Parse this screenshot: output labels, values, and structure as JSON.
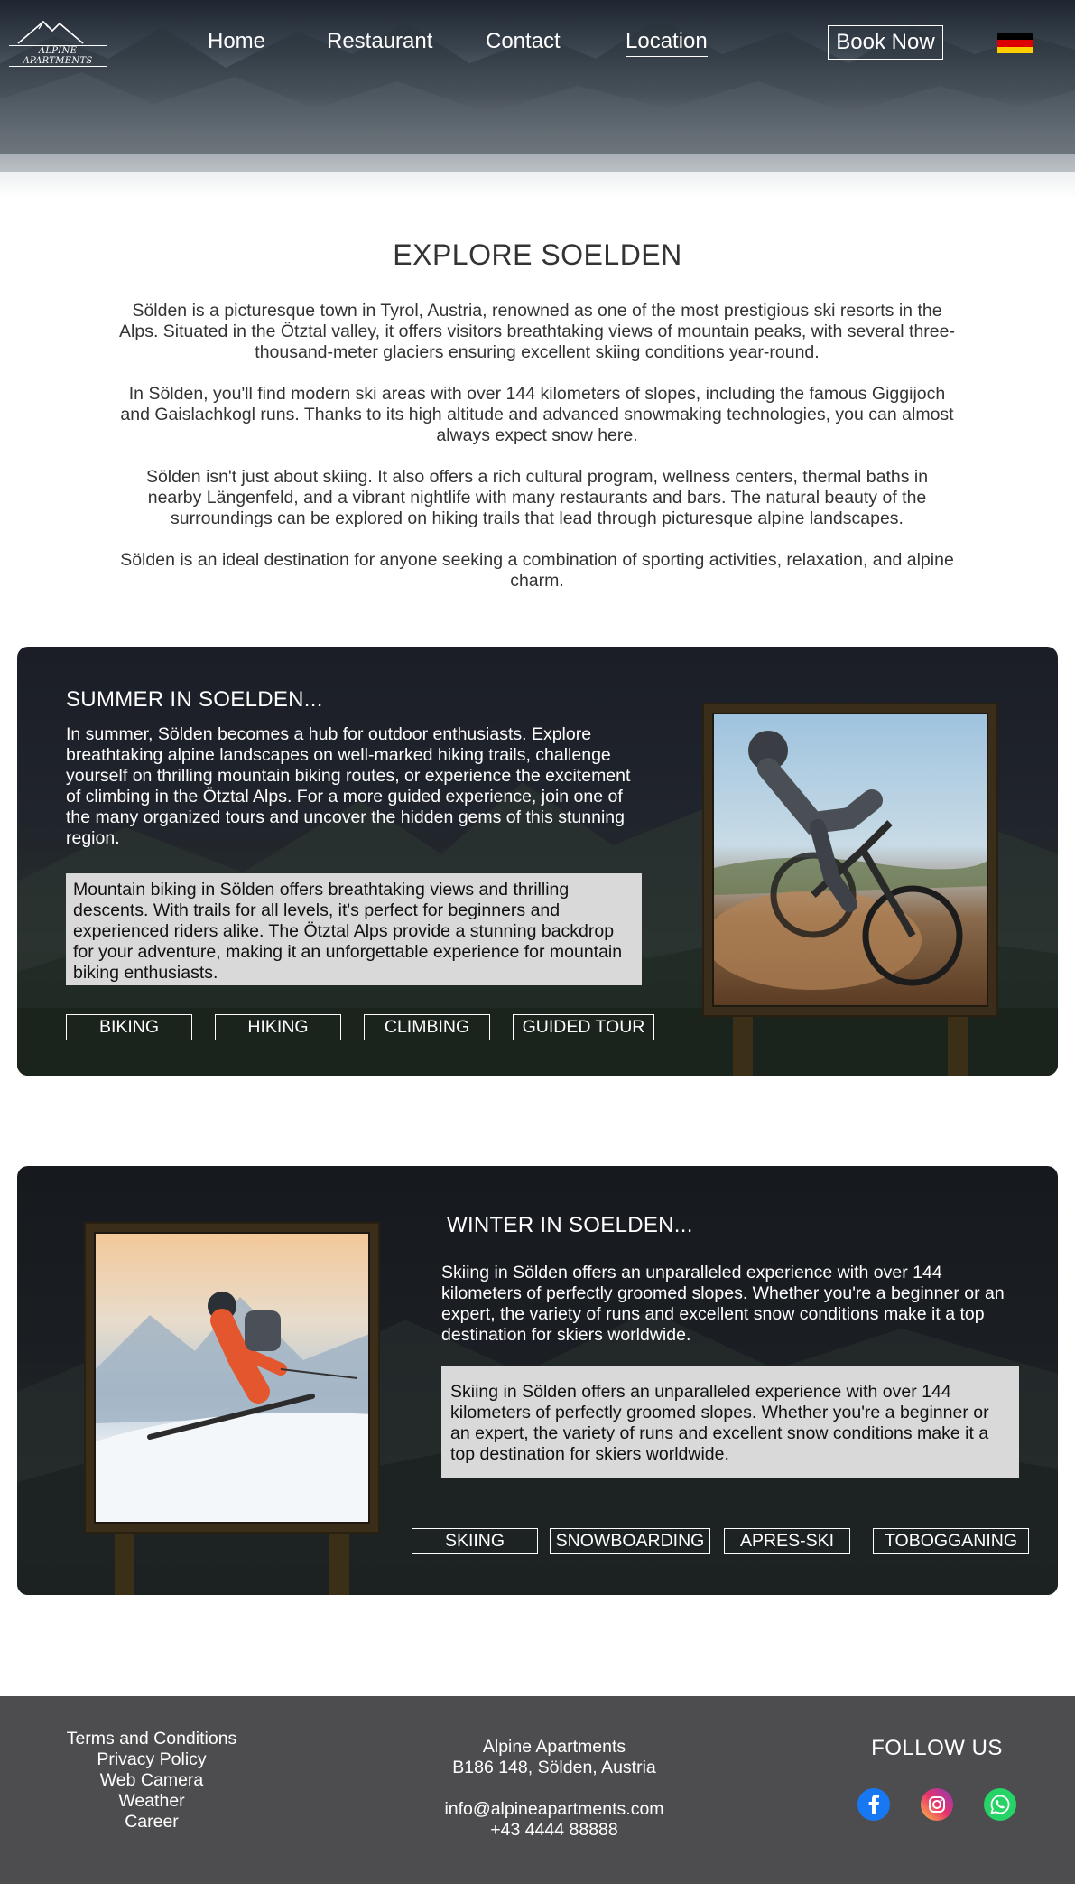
{
  "header": {
    "logo_text": "ALPINE APARTMENTS",
    "nav": [
      {
        "label": "Home",
        "active": false
      },
      {
        "label": "Restaurant",
        "active": false
      },
      {
        "label": "Contact",
        "active": false
      },
      {
        "label": "Location",
        "active": true
      }
    ],
    "book_label": "Book Now",
    "language_flag": "german-flag-icon"
  },
  "intro": {
    "title": "EXPLORE SOELDEN",
    "paragraphs": [
      "Sölden is a picturesque town in Tyrol, Austria, renowned as one of the most prestigious ski resorts in the Alps. Situated in the Ötztal valley, it offers visitors breathtaking views of mountain peaks, with several three-thousand-meter glaciers ensuring excellent skiing conditions year-round.",
      "In Sölden, you'll find modern ski areas with over 144 kilometers of slopes, including the famous Giggijoch and Gaislachkogl runs. Thanks to its high altitude and advanced snowmaking technologies, you can almost always expect snow here.",
      "Sölden isn't just about skiing. It also offers a rich cultural program, wellness centers, thermal baths in nearby Längenfeld, and a vibrant nightlife with many restaurants and bars. The natural beauty of the surroundings can be explored on hiking trails that lead through picturesque alpine landscapes.",
      "Sölden is an ideal destination for anyone seeking a combination of sporting activities, relaxation, and alpine charm."
    ]
  },
  "summer": {
    "title": "SUMMER IN SOELDEN...",
    "text": "In summer, Sölden becomes a hub for outdoor enthusiasts. Explore breathtaking alpine landscapes on well-marked hiking trails, challenge yourself on thrilling mountain biking routes, or experience the excitement of climbing in the Ötztal Alps. For a more guided experience, join one of the many organized tours and uncover the hidden gems of this stunning region.",
    "box": "Mountain biking in Sölden offers breathtaking views and thrilling descents. With trails for all levels, it's perfect for beginners and experienced riders alike. The Ötztal Alps provide a stunning backdrop for your adventure, making it an unforgettable experience for mountain biking enthusiasts.",
    "tags": [
      "BIKING",
      "HIKING",
      "CLIMBING",
      "GUIDED TOUR"
    ]
  },
  "winter": {
    "title": "WINTER IN SOELDEN...",
    "text": "Skiing in Sölden offers an unparalleled experience with over 144 kilometers of perfectly groomed slopes. Whether you're a beginner or an expert, the variety of runs and excellent snow conditions make it a top destination for skiers worldwide.",
    "box": "Skiing in Sölden offers an unparalleled experience with over 144 kilometers of perfectly groomed slopes. Whether you're a beginner or an expert, the variety of runs and excellent snow conditions make it a top destination for skiers worldwide.",
    "tags": [
      "SKIING",
      "SNOWBOARDING",
      "APRES-SKI",
      "TOBOGGANING"
    ]
  },
  "footer": {
    "links": [
      "Terms and Conditions",
      "Privacy Policy",
      "Web Camera",
      "Weather",
      "Career"
    ],
    "company": "Alpine Apartments",
    "address": "B186 148, Sölden, Austria",
    "email": "info@alpineapartments.com",
    "phone": "+43 4444 88888",
    "follow_title": "FOLLOW US",
    "social": [
      "facebook-icon",
      "instagram-icon",
      "whatsapp-icon"
    ]
  },
  "colors": {
    "panel_bg": "#1f232b",
    "box_bg": "#d9d9d9",
    "footer_bg": "#4d4d4f",
    "flag": [
      "#000000",
      "#dd0000",
      "#ffce00"
    ]
  }
}
